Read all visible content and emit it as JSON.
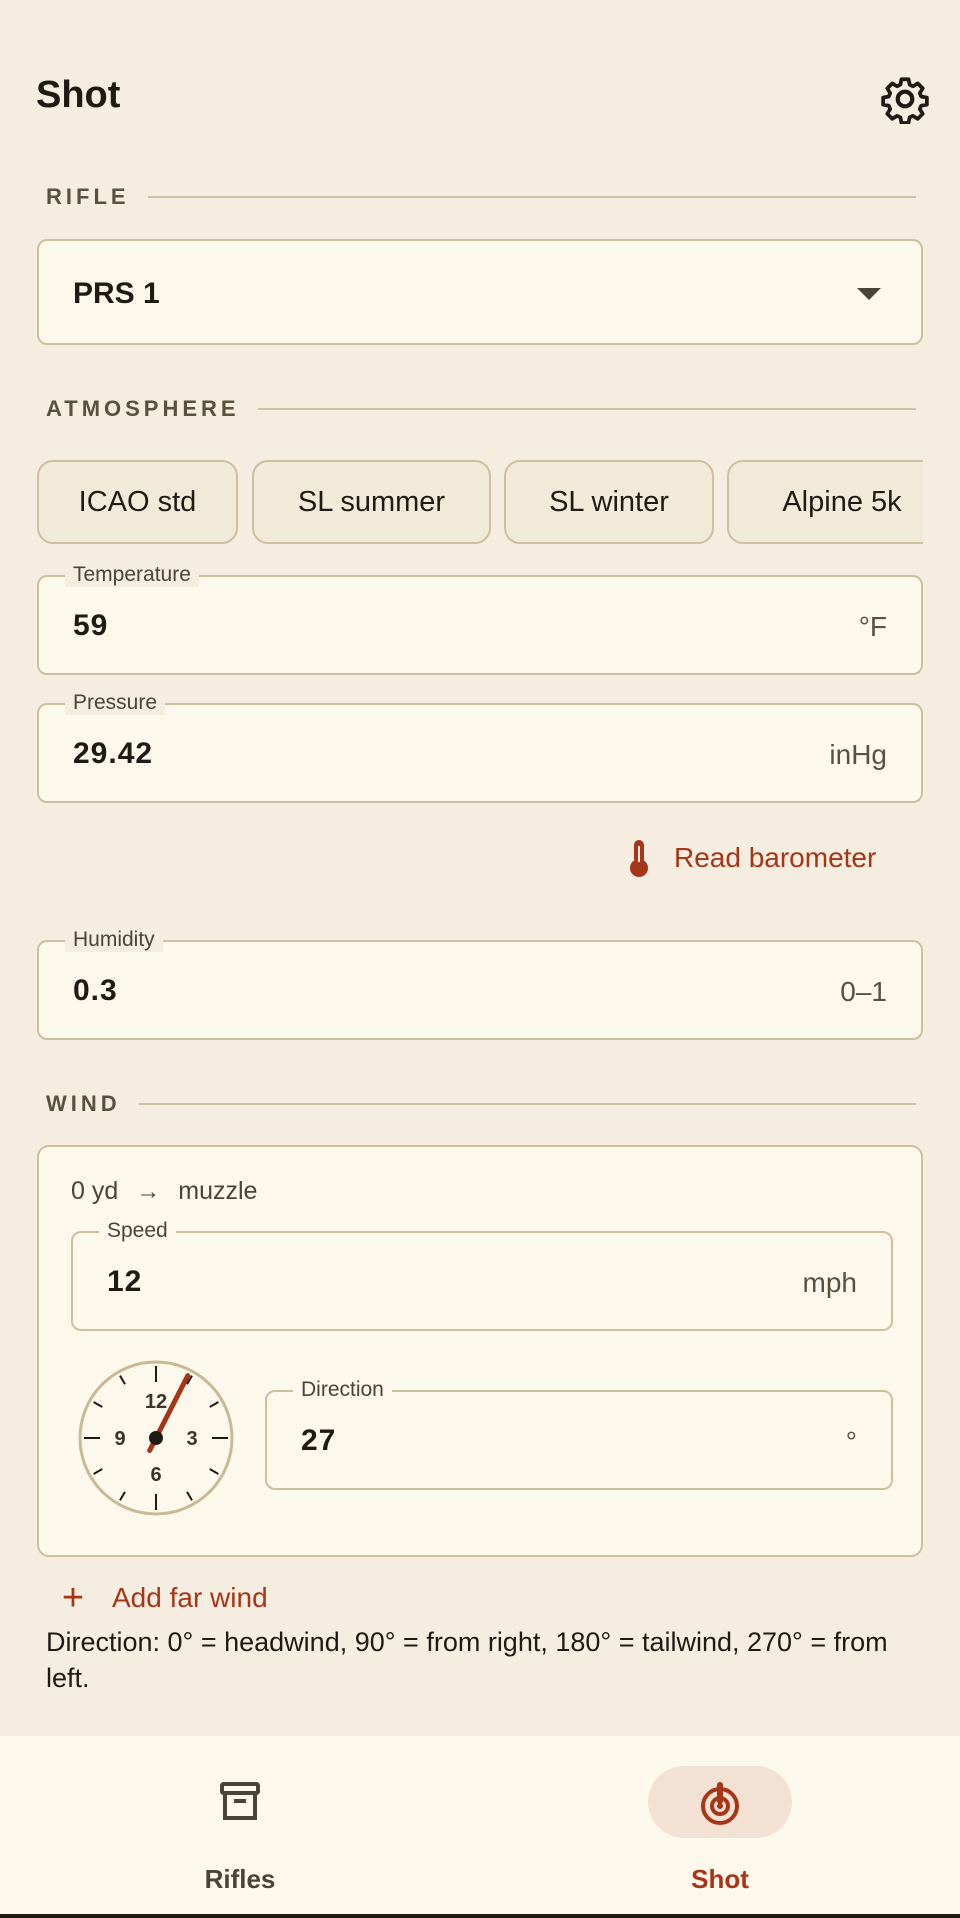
{
  "app_bar": {
    "title": "Shot",
    "settings_icon": "gear-icon"
  },
  "rifle": {
    "section_label": "RIFLE",
    "selected": "PRS 1"
  },
  "atmosphere": {
    "section_label": "ATMOSPHERE",
    "presets": [
      "ICAO std",
      "SL summer",
      "SL winter",
      "Alpine 5k"
    ],
    "temperature": {
      "label": "Temperature",
      "value": "59",
      "unit": "°F"
    },
    "pressure": {
      "label": "Pressure",
      "value": "29.42",
      "unit": "inHg"
    },
    "barometer_button": "Read barometer",
    "humidity": {
      "label": "Humidity",
      "value": "0.3",
      "unit": "0–1"
    }
  },
  "wind": {
    "section_label": "WIND",
    "range_from": "0 yd",
    "range_arrow": "→",
    "range_to": "muzzle",
    "speed": {
      "label": "Speed",
      "value": "12",
      "unit": "mph"
    },
    "direction": {
      "label": "Direction",
      "value": "27",
      "unit": "°"
    },
    "dial_labels": {
      "top": "12",
      "right": "3",
      "bottom": "6",
      "left": "9"
    },
    "direction_degrees": 27,
    "add_far_wind": "Add far wind",
    "add_icon": "+",
    "hint": "Direction: 0° = headwind, 90° = from right, 180° = tailwind, 270° = from left."
  },
  "nav": {
    "items": [
      {
        "label": "Rifles",
        "icon": "archive-box-icon",
        "active": false
      },
      {
        "label": "Shot",
        "icon": "target-icon",
        "active": true
      }
    ]
  },
  "colors": {
    "background": "#f4ede0",
    "surface": "#fdf8ec",
    "border": "#cdbf9f",
    "accent": "#a63618",
    "active_pill": "#f3e1d3"
  }
}
